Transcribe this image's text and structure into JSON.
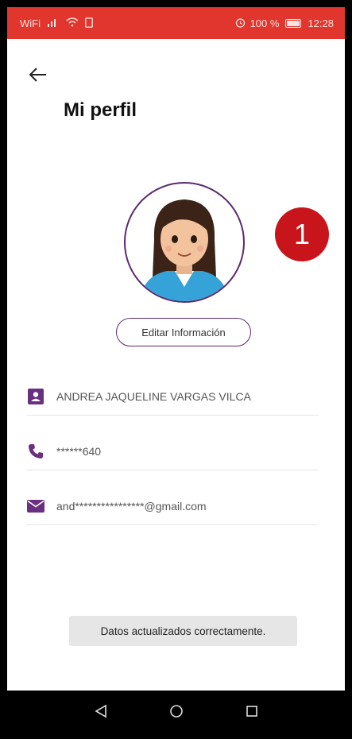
{
  "status_bar": {
    "carrier": "WiFi",
    "alarm_icon": "alarm-icon",
    "battery_percent": "100 %",
    "time": "12:28"
  },
  "header": {
    "back_icon": "arrow-left-icon",
    "title": "Mi perfil"
  },
  "profile": {
    "avatar_icon": "woman-avatar-icon",
    "badge": "1",
    "edit_label": "Editar Información"
  },
  "info": {
    "name": "ANDREA JAQUELINE VARGAS VILCA",
    "phone": "******640",
    "email": "and****************@gmail.com"
  },
  "toast": {
    "message": "Datos actualizados correctamente."
  },
  "colors": {
    "status_bar": "#e0362d",
    "accent": "#5a2a6e",
    "badge": "#c8141b"
  }
}
